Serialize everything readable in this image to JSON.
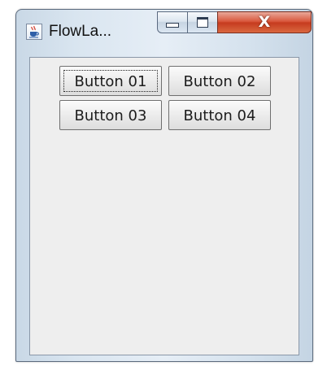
{
  "window": {
    "title": "FlowLa...",
    "close_glyph": "X",
    "icon": "java-coffee-cup-icon"
  },
  "buttons": [
    {
      "label": "Button 01",
      "focused": true
    },
    {
      "label": "Button 02",
      "focused": false
    },
    {
      "label": "Button 03",
      "focused": false
    },
    {
      "label": "Button 04",
      "focused": false
    }
  ],
  "colors": {
    "close_button": "#c63b1f",
    "client_background": "#eeeeee",
    "frame": "#d9e5f0"
  }
}
